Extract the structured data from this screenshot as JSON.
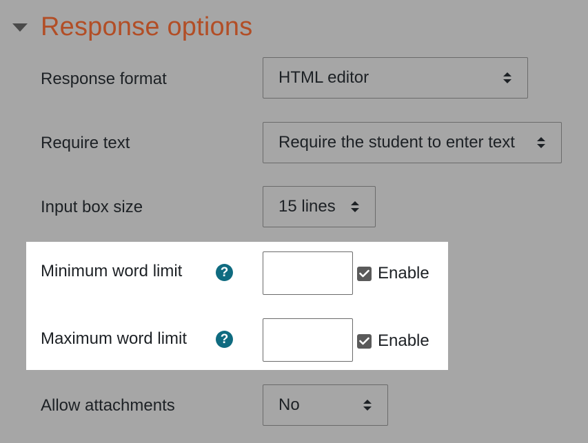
{
  "section": {
    "title": "Response options",
    "collapse_icon": "triangle-down-icon",
    "title_color": "#b24e26"
  },
  "fields": {
    "response_format": {
      "label": "Response format",
      "selected": "HTML editor"
    },
    "require_text": {
      "label": "Require text",
      "selected": "Require the student to enter text"
    },
    "input_box_size": {
      "label": "Input box size",
      "selected": "15 lines"
    },
    "min_word_limit": {
      "label": "Minimum word limit",
      "help_icon": "question-circle-icon",
      "help_glyph": "?",
      "value": "",
      "enable_checked": true,
      "enable_label": "Enable"
    },
    "max_word_limit": {
      "label": "Maximum word limit",
      "help_icon": "question-circle-icon",
      "help_glyph": "?",
      "value": "",
      "enable_checked": true,
      "enable_label": "Enable"
    },
    "allow_attachments": {
      "label": "Allow attachments",
      "selected": "No"
    }
  },
  "colors": {
    "background": "#a6a6a6",
    "highlight": "#ffffff",
    "help_icon": "#0f6b80",
    "checkbox": "#5a5a5a"
  }
}
